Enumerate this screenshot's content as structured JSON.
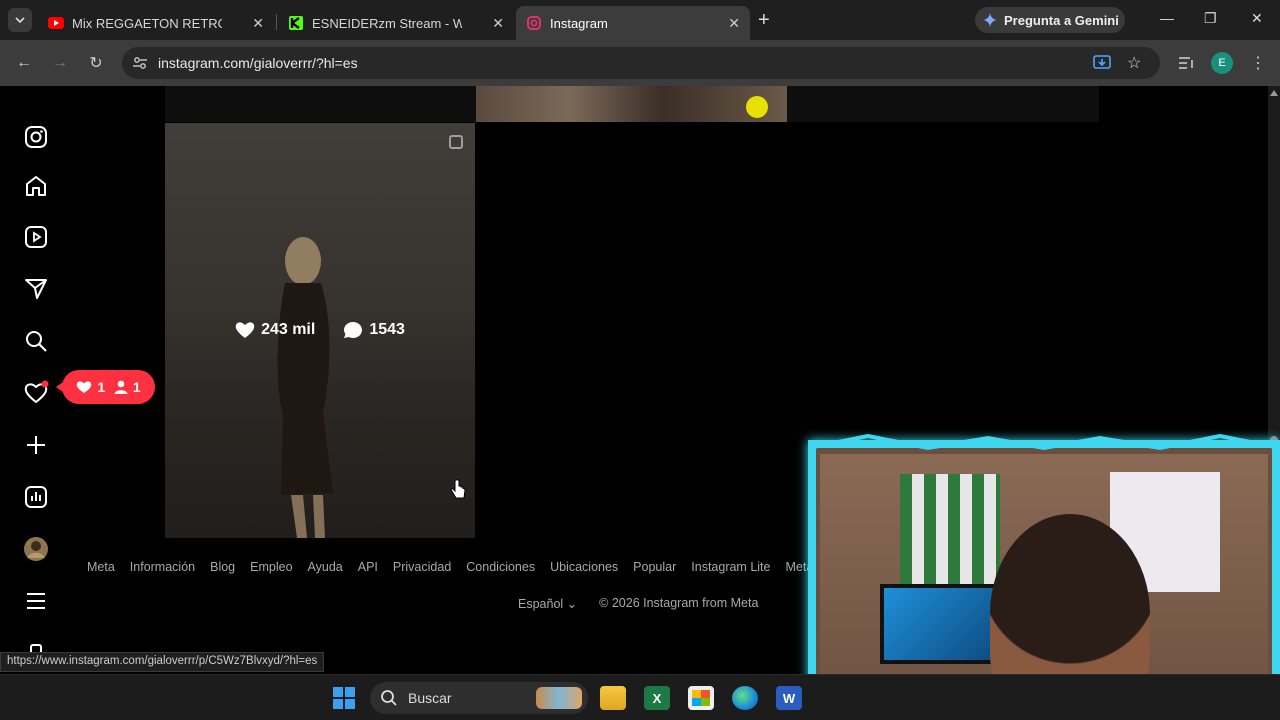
{
  "browser": {
    "tabs": [
      {
        "title": "Mix REGGAETON RETRO (Old S",
        "favicon": "youtube-icon",
        "color": "#ff0000"
      },
      {
        "title": "ESNEIDERzm Stream - Watch Li",
        "favicon": "kick-icon",
        "color": "#53fc18"
      },
      {
        "title": "Instagram",
        "favicon": "instagram-icon",
        "color": "#e1306c"
      }
    ],
    "gemini_label": "Pregunta a Gemini",
    "url": "instagram.com/gialoverrr/?hl=es",
    "profile_initial": "E"
  },
  "instagram": {
    "sidebar_icons": [
      "instagram-logo-icon",
      "home-icon",
      "reels-icon",
      "messages-icon",
      "search-icon",
      "notifications-heart-icon",
      "create-plus-icon",
      "dashboard-icon",
      "profile-avatar",
      "more-menu-icon"
    ],
    "notification_pill": {
      "likes": "1",
      "follows": "1"
    },
    "post": {
      "likes": "243 mil",
      "comments": "1543"
    },
    "footer_links": [
      "Meta",
      "Información",
      "Blog",
      "Empleo",
      "Ayuda",
      "API",
      "Privacidad",
      "Condiciones",
      "Ubicaciones",
      "Popular",
      "Instagram Lite",
      "Meta A"
    ],
    "language": "Español",
    "copyright": "© 2026 Instagram from Meta"
  },
  "status_url": "https://www.instagram.com/gialoverrr/p/C5Wz7Blvxyd/?hl=es",
  "taskbar": {
    "search_label": "Buscar",
    "apps": [
      "file-explorer-icon",
      "excel-icon",
      "microsoft-store-icon",
      "edge-icon",
      "word-icon"
    ]
  }
}
